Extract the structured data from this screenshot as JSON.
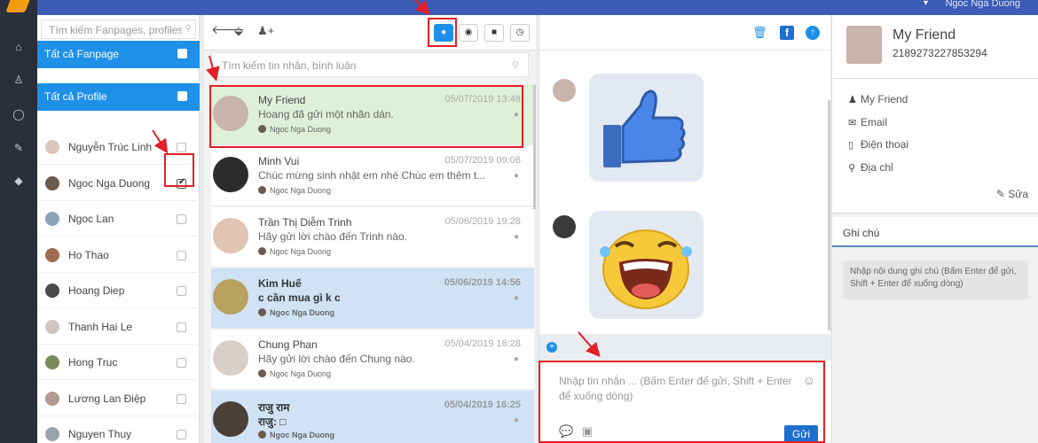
{
  "topbar": {
    "user_label": "Ngoc Nga Duong",
    "user_icon": "chevron-down-icon",
    "logo": "app-logo"
  },
  "leftnav": {
    "icons": [
      "home-icon",
      "user-icon",
      "chat-icon",
      "attachment-icon",
      "tags-icon"
    ]
  },
  "accounts": {
    "search_placeholder": "Tìm kiếm Fanpages, profiles",
    "all_fanpages_label": "Tất cả Fanpage",
    "all_profiles_label": "Tất cả Profile",
    "items": [
      {
        "name": "Nguyễn Trúc Linh",
        "checked": false,
        "avatar_color": "#d9c7c0"
      },
      {
        "name": "Ngoc Nga Duong",
        "checked": true,
        "avatar_color": "#6b5a4e"
      },
      {
        "name": "Ngoc Lan",
        "checked": false,
        "avatar_color": "#8fa3b8"
      },
      {
        "name": "Ho Thao",
        "checked": false,
        "avatar_color": "#a06a50"
      },
      {
        "name": "Hoang Diep",
        "checked": false,
        "avatar_color": "#4a4a4a"
      },
      {
        "name": "Thanh Hai Le",
        "checked": false,
        "avatar_color": "#cfc6c2"
      },
      {
        "name": "Hong Truc",
        "checked": false,
        "avatar_color": "#7a8a5a"
      },
      {
        "name": "Lương Lan Điệp",
        "checked": false,
        "avatar_color": "#b09a90"
      },
      {
        "name": "Nguyen Thuy",
        "checked": false,
        "avatar_color": "#9aa4a8"
      }
    ]
  },
  "conversations": {
    "toolbar": {
      "back_icon": "arrow-left-icon",
      "tag_icon": "tags-icon",
      "add_user_icon": "user-plus-icon",
      "filters": [
        "chat-bubble-icon",
        "eye-icon",
        "comment-icon",
        "clock-icon"
      ],
      "active_filter": "chat-bubble-icon"
    },
    "search_placeholder": "Tìm kiếm tin nhắn, bình luận",
    "items": [
      {
        "name": "My Friend",
        "time": "05/07/2019 13:48",
        "preview": "Hoang đã gửi một nhãn dán.",
        "page": "Ngoc Nga Duong",
        "state": "selected",
        "avatar_color": "#c9b3ad"
      },
      {
        "name": "Minh Vui",
        "time": "05/07/2019 09:06",
        "preview": "Chúc mừng sinh nhật em nhé Chúc em thêm t...",
        "page": "Ngoc Nga Duong",
        "state": "read",
        "avatar_color": "#2c2c2c"
      },
      {
        "name": "Trần Thị Diễm Trinh",
        "time": "05/06/2019 19:28",
        "preview": "Hãy gửi lời chào đến Trinh nào.",
        "page": "Ngoc Nga Duong",
        "state": "read",
        "avatar_color": "#e0c4b4"
      },
      {
        "name": "Kim Huế",
        "time": "05/06/2019 14:56",
        "preview": "c cần mua gì k c",
        "page": "Ngoc Nga Duong",
        "state": "unread",
        "avatar_color": "#b8a060"
      },
      {
        "name": "Chung Phan",
        "time": "05/04/2019 16:28",
        "preview": "Hãy gửi lời chào đến Chung nào.",
        "page": "Ngoc Nga Duong",
        "state": "read",
        "avatar_color": "#d8cfc8"
      },
      {
        "name": "राजु राम",
        "time": "05/04/2019 16:25",
        "preview": "राजु: □",
        "page": "Ngoc Nga Duong",
        "state": "unread",
        "avatar_color": "#4a4038"
      }
    ]
  },
  "chat": {
    "actions": [
      "trash-icon",
      "facebook-icon",
      "upload-icon"
    ],
    "messages": [
      {
        "type": "sticker",
        "sticker": "thumbs-up-sticker",
        "avatar_color": "#c9b3ad"
      },
      {
        "type": "sticker",
        "sticker": "laughing-emoji-sticker",
        "avatar_color": "#3a3a3a"
      }
    ],
    "composer_placeholder": "Nhập tin nhắn ... (Bấm Enter để gửi, Shift + Enter để xuống dòng)",
    "send_label": "Gửi"
  },
  "profile": {
    "name": "My Friend",
    "id": "2189273227853294",
    "fields": [
      {
        "icon": "user-icon",
        "label": "My Friend"
      },
      {
        "icon": "envelope-icon",
        "label": "Email"
      },
      {
        "icon": "phone-icon",
        "label": "Điện thoại"
      },
      {
        "icon": "map-marker-icon",
        "label": "Địa chỉ"
      }
    ],
    "edit_label": "Sửa",
    "notes_tab_label": "Ghi chú",
    "notes_placeholder": "Nhập nội dung ghi chú (Bấm Enter để gửi, Shift + Enter để xuống dòng)"
  },
  "colors": {
    "accent": "#1e90e8",
    "sidebar": "#2a2f3a",
    "topbar": "#3b5bb5",
    "highlight": "#e21f26",
    "selected_row": "#dff0d8",
    "unread_row": "#cfe3f5"
  }
}
